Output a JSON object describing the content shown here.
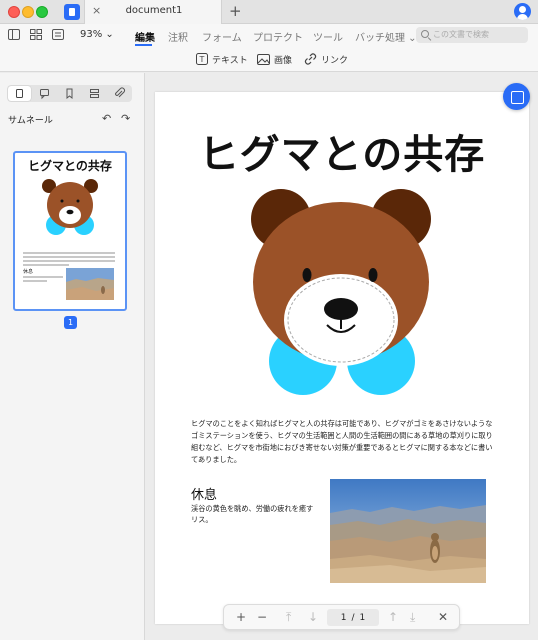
{
  "window": {
    "tab_title": "document1",
    "tab_close": "×",
    "tab_add": "+"
  },
  "toolbar": {
    "zoom": "93% ⌄",
    "menu": [
      "編集",
      "注釈",
      "フォーム",
      "プロテクト",
      "ツール",
      "バッチ処理 ⌄"
    ],
    "search_placeholder": "この文書で検索"
  },
  "subbar": {
    "items": [
      "テキスト",
      "画像",
      "リンク"
    ]
  },
  "sidebar": {
    "title": "サムネール",
    "rotate_left": "↶",
    "rotate_right": "↷",
    "page_badge": "1"
  },
  "document": {
    "title": "ヒグマとの共存",
    "body": "ヒグマのことをよく知ればヒグマと人の共存は可能であり、ヒグマがゴミをあさけないようなゴミステーションを使う、ヒグマの生活範囲と人間の生活範囲の間にある草地の草刈りに取り組むなど、ヒグマを市街地におびき寄せない対策が重要であるとヒグマに関する本などに書いてありました。",
    "section_title": "休息",
    "section_body": "渓谷の黄色を眺め、労働の疲れを癒すリス。"
  },
  "thumbnail": {
    "title": "ヒグマとの共存",
    "section_title": "休息"
  },
  "bottom_nav": {
    "zoom_in": "+",
    "zoom_out": "−",
    "first": "⤒",
    "prev_down": "↓",
    "current_page": "1",
    "separator": "/",
    "total_pages": "1",
    "up": "↑",
    "last": "⤓",
    "close": "✕"
  },
  "colors": {
    "accent": "#2a6cf6",
    "bear_brown": "#9b5228",
    "bear_ear": "#5a2708",
    "bow_cyan": "#2ad1ff"
  }
}
